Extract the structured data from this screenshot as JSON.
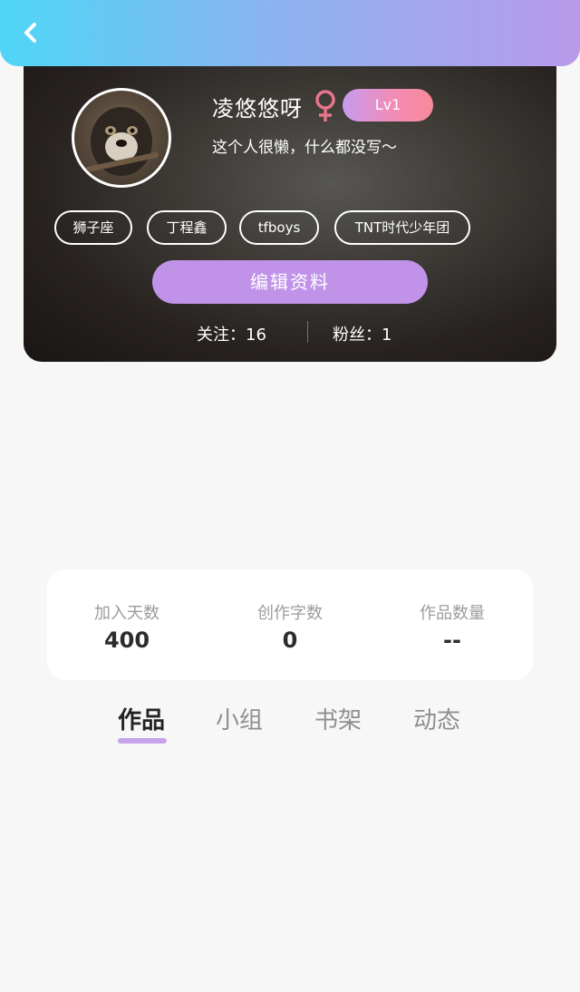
{
  "profile": {
    "username": "凌悠悠呀",
    "gender_icon": "female-icon",
    "level": "Lv1",
    "bio": "这个人很懒，什么都没写～",
    "tags": [
      "狮子座",
      "丁程鑫",
      "tfboys",
      "TNT时代少年团"
    ],
    "edit_label": "编辑资料",
    "follow": "关注：16",
    "fans": "粉丝：1"
  },
  "stats": [
    {
      "label": "加入天数",
      "value": "400"
    },
    {
      "label": "创作字数",
      "value": "0"
    },
    {
      "label": "作品数量",
      "value": "--"
    }
  ],
  "tabs": [
    "作品",
    "小组",
    "书架",
    "动态"
  ],
  "colors": {
    "header_gradient_start": "#4fd6f7",
    "header_gradient_end": "#b89ae9",
    "accent_purple": "#c093e8",
    "level_pink": "#f78a99",
    "gender_pink": "#e8758c"
  }
}
